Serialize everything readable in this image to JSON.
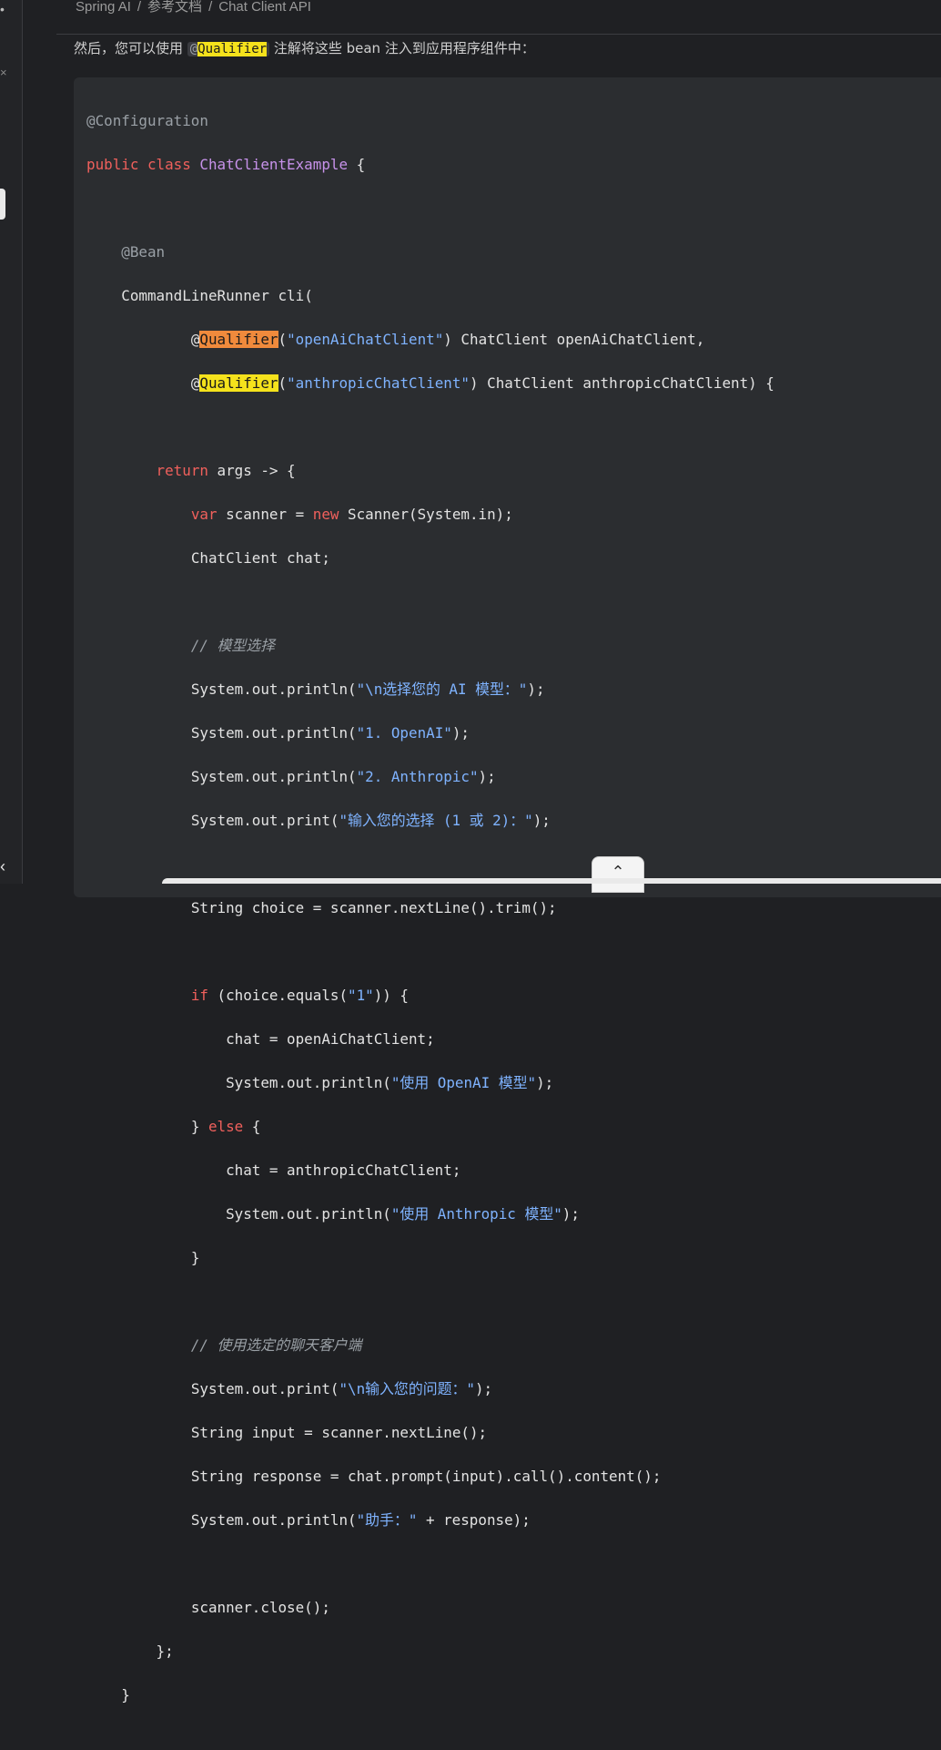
{
  "breadcrumb": [
    "Spring AI",
    "参考文档",
    "Chat Client API"
  ],
  "intro": {
    "before": "然后，您可以使用 ",
    "chip_prefix": "@",
    "chip_highlight": "Qualifier",
    "after": " 注解将这些 bean 注入到应用程序组件中："
  },
  "code": {
    "l1": "@Configuration",
    "l2_kw": "public class ",
    "l2_cls": "ChatClientExample",
    "l2_rest": " {",
    "l4": "@Bean",
    "l5": "CommandLineRunner cli(",
    "q_prefix": "@",
    "q_word": "Qualifier",
    "l6_open": "(",
    "l6_str": "\"openAiChatClient\"",
    "l6_rest": ") ChatClient openAiChatClient,",
    "l7_str": "\"anthropicChatClient\"",
    "l7_rest": ") ChatClient anthropicChatClient) {",
    "kw_return": "return",
    "l9_rest": " args -> {",
    "kw_var": "var",
    "l10_mid": " scanner = ",
    "kw_new": "new",
    "l10_rest": " Scanner(System.in);",
    "l11": "ChatClient chat;",
    "c1": "// 模型选择",
    "println": "System.out.println(",
    "print": "System.out.print(",
    "close": ");",
    "s1": "\"\\n选择您的 AI 模型：\"",
    "s2": "\"1. OpenAI\"",
    "s3": "\"2. Anthropic\"",
    "s4": "\"输入您的选择 (1 或 2)：\"",
    "l18": "String choice = scanner.nextLine().trim();",
    "kw_if": "if",
    "l20_a": " (choice.equals(",
    "s5": "\"1\"",
    "l20_b": ")) {",
    "l21": "chat = openAiChatClient;",
    "s6": "\"使用 OpenAI 模型\"",
    "l23_a": "} ",
    "kw_else": "else",
    "l23_b": " {",
    "l24": "chat = anthropicChatClient;",
    "s7": "\"使用 Anthropic 模型\"",
    "l26": "}",
    "c2": "// 使用选定的聊天客户端",
    "s8": "\"\\n输入您的问题：\"",
    "l29": "String input = scanner.nextLine();",
    "l30": "String response = chat.prompt(input).call().content();",
    "s9": "\"助手：\"",
    "l31_rest": " + response);",
    "l33": "scanner.close();",
    "l34": "};",
    "l35": "}"
  },
  "icons": {
    "scroll_up": "chevron-up-icon",
    "collapse": "chevron-left-icon"
  }
}
